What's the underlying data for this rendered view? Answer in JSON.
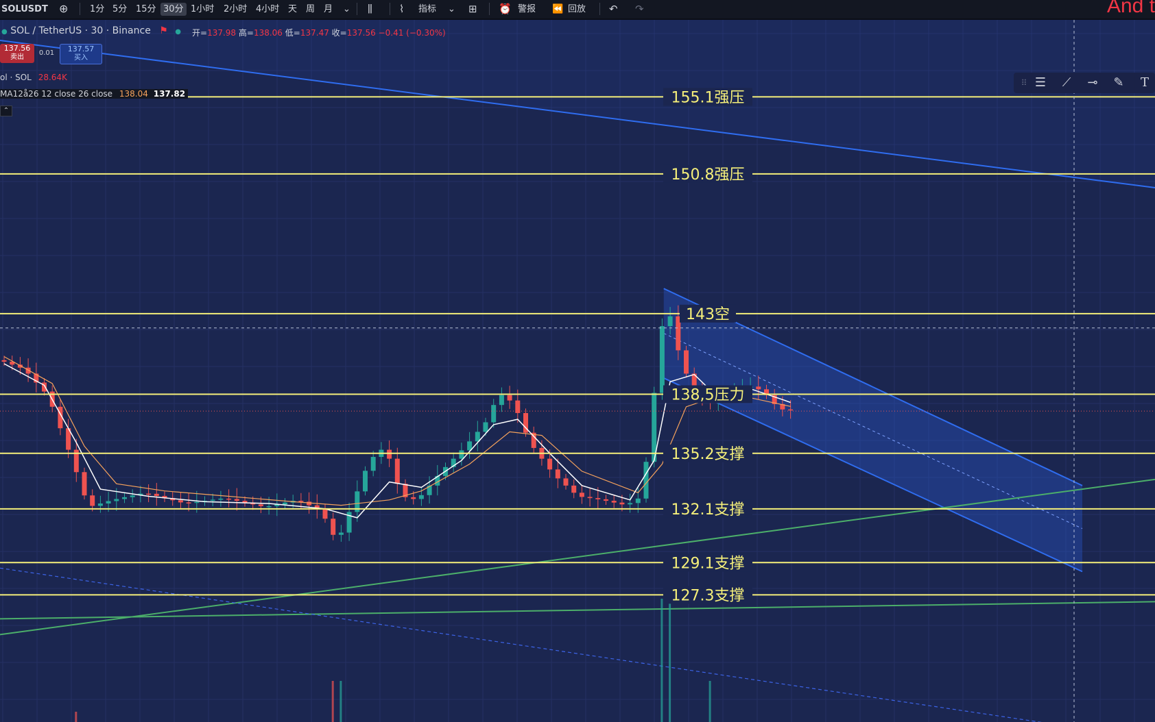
{
  "toolbar": {
    "symbol": "SOLUSDT",
    "intervals": [
      "1分",
      "5分",
      "15分",
      "30分",
      "1小时",
      "2小时",
      "4小时",
      "天",
      "周",
      "月"
    ],
    "active_interval": "30分",
    "indicators_label": "指标",
    "alert_label": "警报",
    "replay_label": "回放"
  },
  "overlay_text": "And t",
  "legend": {
    "title": "SOL / TetherUS · 30 · Binance",
    "open_label": "开=",
    "open": "137.98",
    "high_label": "高=",
    "high": "138.06",
    "low_label": "低=",
    "low": "137.47",
    "close_label": "收=",
    "close": "137.56",
    "change": "−0.41 (−0.30%)",
    "sell_price": "137.56",
    "sell_label": "卖出",
    "spread": "0.01",
    "buy_price": "137.57",
    "buy_label": "买入",
    "volume_name": "ol · SOL",
    "volume_value": "28.64K",
    "ma_name": "MA12å26 12 close 26 close",
    "ma1_value": "138.04",
    "ma2_value": "137.82"
  },
  "colors": {
    "background": "#1b2650",
    "level_line": "#f6f07a",
    "up": "#26a69a",
    "down": "#ef5350",
    "trendline_blue": "#2f6df0",
    "trendline_green": "#4caf6a",
    "channel_fill": "#2a5bd6"
  },
  "chart_data": {
    "type": "candlestick",
    "symbol": "SOL / TetherUS",
    "interval": "30",
    "exchange": "Binance",
    "y_range": [
      120.2,
      159.4
    ],
    "levels": [
      {
        "price": 155.1,
        "label": "155.1强压"
      },
      {
        "price": 150.8,
        "label": "150.8强压"
      },
      {
        "price": 143,
        "label": "143空"
      },
      {
        "price": 138.5,
        "label": "138,5压力"
      },
      {
        "price": 135.2,
        "label": "135.2支撑"
      },
      {
        "price": 132.1,
        "label": "132.1支撑"
      },
      {
        "price": 129.1,
        "label": "129.1支撑"
      },
      {
        "price": 127.3,
        "label": "127.3支撑"
      }
    ],
    "price_path": [
      [
        0,
        140.4
      ],
      [
        3,
        139.9
      ],
      [
        6,
        138.4
      ],
      [
        9,
        134.8
      ],
      [
        11,
        132.2
      ],
      [
        14,
        132.6
      ],
      [
        18,
        133.0
      ],
      [
        23,
        132.4
      ],
      [
        28,
        132.7
      ],
      [
        33,
        132.2
      ],
      [
        37,
        132.6
      ],
      [
        40,
        132.0
      ],
      [
        42,
        130.2
      ],
      [
        44,
        132.5
      ],
      [
        46,
        134.8
      ],
      [
        48,
        135.6
      ],
      [
        50,
        132.8
      ],
      [
        52,
        132.6
      ],
      [
        55,
        134.2
      ],
      [
        58,
        135.6
      ],
      [
        61,
        137.2
      ],
      [
        62,
        138.6
      ],
      [
        64,
        138.0
      ],
      [
        66,
        135.8
      ],
      [
        69,
        134.0
      ],
      [
        72,
        132.8
      ],
      [
        75,
        132.6
      ],
      [
        78,
        132.3
      ],
      [
        80,
        132.8
      ],
      [
        82,
        140.5
      ],
      [
        83,
        144.1
      ],
      [
        84,
        141.6
      ],
      [
        86,
        139.0
      ],
      [
        88,
        138.0
      ],
      [
        91,
        138.7
      ],
      [
        93,
        139.0
      ],
      [
        95,
        138.7
      ],
      [
        97,
        137.7
      ],
      [
        98,
        137.6
      ]
    ],
    "ma_fast": [
      [
        0,
        140.2
      ],
      [
        5,
        139.0
      ],
      [
        9,
        135.8
      ],
      [
        12,
        133.2
      ],
      [
        18,
        132.8
      ],
      [
        25,
        132.5
      ],
      [
        33,
        132.4
      ],
      [
        40,
        132.1
      ],
      [
        44,
        131.6
      ],
      [
        48,
        133.6
      ],
      [
        52,
        133.3
      ],
      [
        57,
        134.8
      ],
      [
        61,
        136.8
      ],
      [
        64,
        137.1
      ],
      [
        68,
        135.2
      ],
      [
        72,
        133.4
      ],
      [
        78,
        132.6
      ],
      [
        81,
        134.8
      ],
      [
        83,
        139.2
      ],
      [
        86,
        139.6
      ],
      [
        89,
        138.3
      ],
      [
        93,
        138.8
      ],
      [
        97,
        138.2
      ],
      [
        98,
        138.04
      ]
    ],
    "ma_slow": [
      [
        0,
        140.6
      ],
      [
        6,
        139.1
      ],
      [
        10,
        135.6
      ],
      [
        14,
        133.5
      ],
      [
        20,
        133.1
      ],
      [
        28,
        132.8
      ],
      [
        36,
        132.5
      ],
      [
        42,
        132.3
      ],
      [
        48,
        132.6
      ],
      [
        52,
        133.1
      ],
      [
        58,
        134.6
      ],
      [
        63,
        136.4
      ],
      [
        67,
        136.2
      ],
      [
        72,
        134.2
      ],
      [
        79,
        133.0
      ],
      [
        82,
        134.6
      ],
      [
        85,
        137.8
      ],
      [
        89,
        138.4
      ],
      [
        93,
        138.3
      ],
      [
        98,
        137.82
      ]
    ],
    "volume_spikes": [
      {
        "bar": 9,
        "value": 1
      },
      {
        "bar": 41,
        "value": 4
      },
      {
        "bar": 42,
        "value": 4
      },
      {
        "bar": 82,
        "value": 12
      },
      {
        "bar": 83,
        "value": 12
      },
      {
        "bar": 88,
        "value": 4
      }
    ]
  }
}
